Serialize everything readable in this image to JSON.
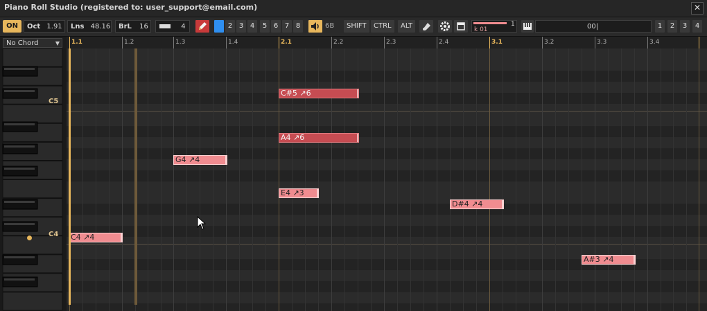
{
  "title": "Piano Roll Studio  (registered to: user_support@email.com)",
  "close_icon": "✕",
  "toolbar": {
    "on_label": "ON",
    "oct_label": "Oct",
    "oct_value": "1.91",
    "lns_label": "Lns",
    "lns_value": "48.16",
    "brl_label": "BrL",
    "brl_value": "16",
    "step_value": "4",
    "snap_numbers": [
      "2",
      "3",
      "4",
      "5",
      "6",
      "7",
      "8"
    ],
    "volume_value": "6B",
    "mods": [
      "SHIFT",
      "CTRL",
      "ALT"
    ],
    "channel_label": "k 01",
    "channel_value": "1",
    "pattern_value": "00|",
    "view_numbers": [
      "1",
      "2",
      "3",
      "4"
    ]
  },
  "chord_select": "No Chord",
  "ruler": [
    "1.1",
    "1.2",
    "1.3",
    "1.4",
    "2.1",
    "2.2",
    "2.3",
    "2.4",
    "3.1",
    "3.2",
    "3.3",
    "3.4"
  ],
  "key_labels": {
    "c5": "C5",
    "c4": "C4"
  },
  "notes": [
    {
      "label": "C#5 ↗6",
      "selected": true
    },
    {
      "label": "A4 ↗6",
      "selected": true
    },
    {
      "label": "G4 ↗4",
      "selected": false
    },
    {
      "label": "E4 ↗3",
      "selected": false
    },
    {
      "label": "D#4 ↗4",
      "selected": false
    },
    {
      "label": "C4 ↗4",
      "selected": false
    },
    {
      "label": "A#3 ↗4",
      "selected": false
    }
  ],
  "colors": {
    "accent": "#e8b75c",
    "note": "#f08c90",
    "note_selected": "#c64c52",
    "background": "#1c1c1c"
  },
  "icons": [
    "pencil-icon",
    "gear-icon",
    "speaker-icon",
    "piano-icon",
    "stamp-icon"
  ]
}
